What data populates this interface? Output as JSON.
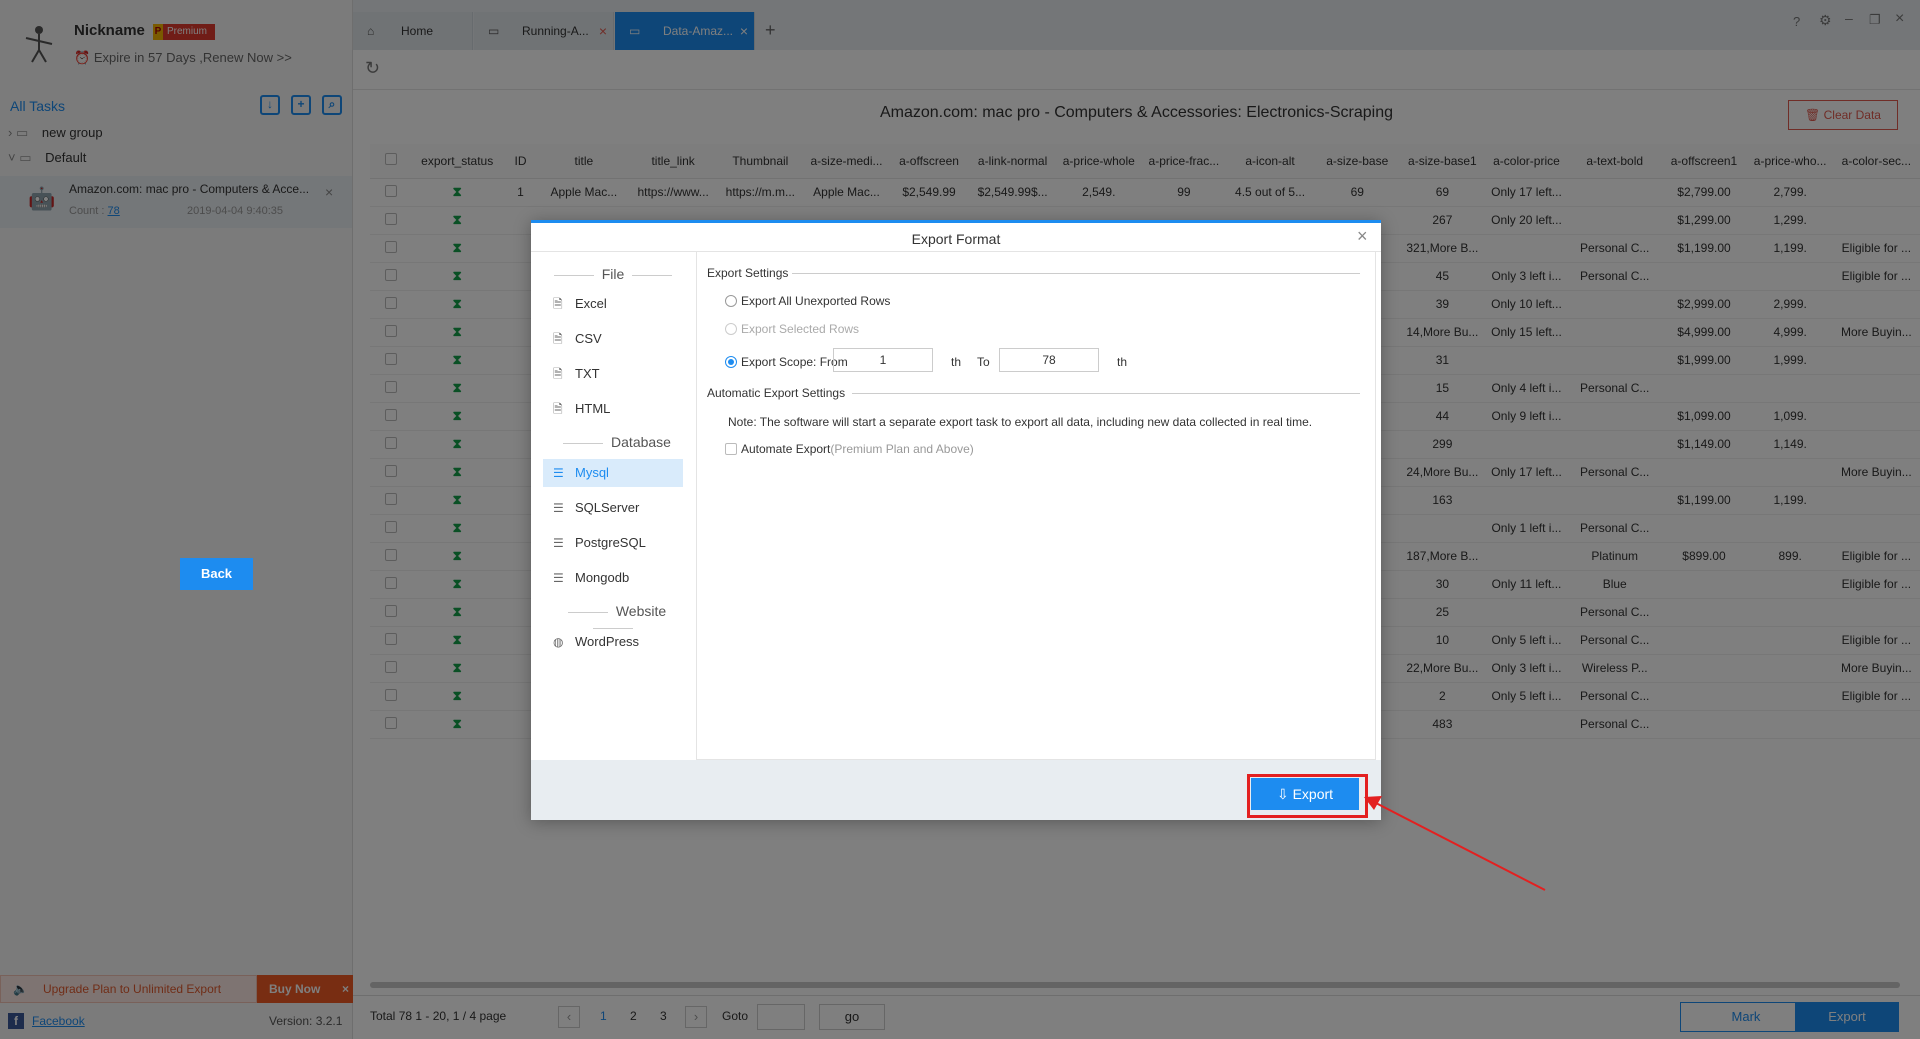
{
  "user": {
    "nickname": "Nickname",
    "badge_p": "P",
    "badge": "Premium",
    "expire": "Expire in 57 Days ,Renew Now >>"
  },
  "sidebar": {
    "all_tasks": "All Tasks",
    "groups": [
      "new group",
      "Default"
    ],
    "task": {
      "title": "Amazon.com: mac pro - Computers & Acce...",
      "count_label": "Count :",
      "count": "78",
      "date": "2019-04-04 9:40:35"
    },
    "upgrade": "Upgrade Plan to Unlimited Export",
    "buy_now": "Buy Now",
    "facebook": "Facebook",
    "version": "Version: 3.2.1"
  },
  "tabs": [
    {
      "label": "Home"
    },
    {
      "label": "Running-A..."
    },
    {
      "label": "Data-Amaz..."
    }
  ],
  "main": {
    "caption": "Amazon.com: mac pro - Computers & Accessories: Electronics-Scraping",
    "clear_data": "Clear Data",
    "columns": [
      "export_status",
      "ID",
      "title",
      "title_link",
      "Thumbnail",
      "a-size-medi...",
      "a-offscreen",
      "a-link-normal",
      "a-price-whole",
      "a-price-frac...",
      "a-icon-alt",
      "a-size-base",
      "a-size-base1",
      "a-color-price",
      "a-text-bold",
      "a-offscreen1",
      "a-price-who...",
      "a-color-sec..."
    ],
    "rows": [
      [
        "1",
        "Apple Mac...",
        "https://www...",
        "https://m.m...",
        "Apple Mac...",
        "$2,549.99",
        "$2,549.99$...",
        "2,549.",
        "99",
        "4.5 out of 5...",
        "69",
        "69",
        "Only 17 left...",
        "",
        "$2,799.00",
        "2,799.",
        ""
      ],
      [
        "",
        "",
        "",
        "",
        "",
        "",
        "",
        "",
        "",
        "",
        "",
        "267",
        "Only 20 left...",
        "",
        "$1,299.00",
        "1,299.",
        ""
      ],
      [
        "",
        "",
        "",
        "",
        "",
        "",
        "",
        "",
        "",
        "",
        "",
        "321,More B...",
        "",
        "Personal C...",
        "$1,199.00",
        "1,199.",
        "Eligible for ..."
      ],
      [
        "",
        "",
        "",
        "",
        "",
        "",
        "",
        "",
        "",
        "",
        "",
        "45",
        "Only 3 left i...",
        "Personal C...",
        "",
        "",
        "Eligible for ..."
      ],
      [
        "",
        "",
        "",
        "",
        "",
        "",
        "",
        "",
        "",
        "",
        "",
        "39",
        "Only 10 left...",
        "",
        "$2,999.00",
        "2,999.",
        ""
      ],
      [
        "",
        "",
        "",
        "",
        "",
        "",
        "",
        "",
        "",
        "",
        "",
        "14,More Bu...",
        "Only 15 left...",
        "",
        "$4,999.00",
        "4,999.",
        "More Buyin..."
      ],
      [
        "",
        "",
        "",
        "",
        "",
        "",
        "",
        "",
        "",
        "",
        "",
        "31",
        "",
        "",
        "$1,999.00",
        "1,999.",
        ""
      ],
      [
        "",
        "",
        "",
        "",
        "",
        "",
        "",
        "",
        "",
        "",
        "",
        "15",
        "Only 4 left i...",
        "Personal C...",
        "",
        "",
        ""
      ],
      [
        "",
        "",
        "",
        "",
        "",
        "",
        "",
        "",
        "",
        "",
        "",
        "44",
        "Only 9 left i...",
        "",
        "$1,099.00",
        "1,099.",
        ""
      ],
      [
        "",
        "",
        "",
        "",
        "",
        "",
        "",
        "",
        "",
        "",
        "",
        "299",
        "",
        "",
        "$1,149.00",
        "1,149.",
        ""
      ],
      [
        "",
        "",
        "",
        "",
        "",
        "",
        "",
        "",
        "",
        "",
        "",
        "24,More Bu...",
        "Only 17 left...",
        "Personal C...",
        "",
        "",
        "More Buyin..."
      ],
      [
        "",
        "",
        "",
        "",
        "",
        "",
        "",
        "",
        "",
        "",
        "",
        "163",
        "",
        "",
        "$1,199.00",
        "1,199.",
        ""
      ],
      [
        "",
        "",
        "",
        "",
        "",
        "",
        "",
        "",
        "",
        "",
        "",
        "",
        "Only 1 left i...",
        "Personal C...",
        "",
        "",
        ""
      ],
      [
        "",
        "",
        "",
        "",
        "",
        "",
        "",
        "",
        "",
        "",
        "",
        "187,More B...",
        "",
        "Platinum",
        "$899.00",
        "899.",
        "Eligible for ..."
      ],
      [
        "",
        "",
        "",
        "",
        "",
        "",
        "",
        "",
        "",
        "",
        "",
        "30",
        "Only 11 left...",
        "Blue",
        "",
        "",
        "Eligible for ..."
      ],
      [
        "",
        "",
        "",
        "",
        "",
        "",
        "",
        "",
        "",
        "",
        "",
        "25",
        "",
        "Personal C...",
        "",
        "",
        ""
      ],
      [
        "",
        "",
        "",
        "",
        "",
        "",
        "",
        "",
        "",
        "",
        "",
        "10",
        "Only 5 left i...",
        "Personal C...",
        "",
        "",
        "Eligible for ..."
      ],
      [
        "",
        "",
        "",
        "",
        "",
        "",
        "",
        "",
        "",
        "",
        "",
        "22,More Bu...",
        "Only 3 left i...",
        "Wireless P...",
        "",
        "",
        "More Buyin..."
      ],
      [
        "",
        "",
        "",
        "",
        "",
        "",
        "",
        "",
        "",
        "",
        "",
        "2",
        "Only 5 left i...",
        "Personal C...",
        "",
        "",
        "Eligible for ..."
      ],
      [
        "",
        "",
        "",
        "",
        "",
        "",
        "",
        "",
        "",
        "",
        "",
        "483",
        "",
        "Personal C...",
        "",
        "",
        ""
      ]
    ]
  },
  "pager": {
    "total_label": "Total",
    "total": "78",
    "range": "1 - 20,",
    "page_of": "1 / 4",
    "page_label": "page",
    "pages": [
      "1",
      "2",
      "3"
    ],
    "goto": "Goto",
    "go": "go",
    "mark": "Mark",
    "export": "Export"
  },
  "dialog": {
    "title": "Export Format",
    "sections": {
      "file": "File",
      "database": "Database",
      "website": "Website"
    },
    "file_options": [
      "Excel",
      "CSV",
      "TXT",
      "HTML"
    ],
    "db_options": [
      "Mysql",
      "SQLServer",
      "PostgreSQL",
      "Mongodb"
    ],
    "web_options": [
      "WordPress"
    ],
    "selected": "Mysql",
    "export_settings": "Export Settings",
    "opt_all": "Export All Unexported Rows",
    "opt_selected": "Export Selected Rows",
    "opt_scope": "Export Scope: From",
    "scope_from": "1",
    "th": "th",
    "to": "To",
    "scope_to": "78",
    "auto_settings": "Automatic Export Settings",
    "note": "Note: The software will start a separate export task to export all data, including new data collected in real time.",
    "auto_export": "Automate Export",
    "auto_export_hint": "(Premium Plan and Above)",
    "back": "Back",
    "export": "Export"
  },
  "colors": {
    "accent": "#1d8cf0",
    "highlight": "#e32020",
    "status_ok": "#15a04a"
  }
}
